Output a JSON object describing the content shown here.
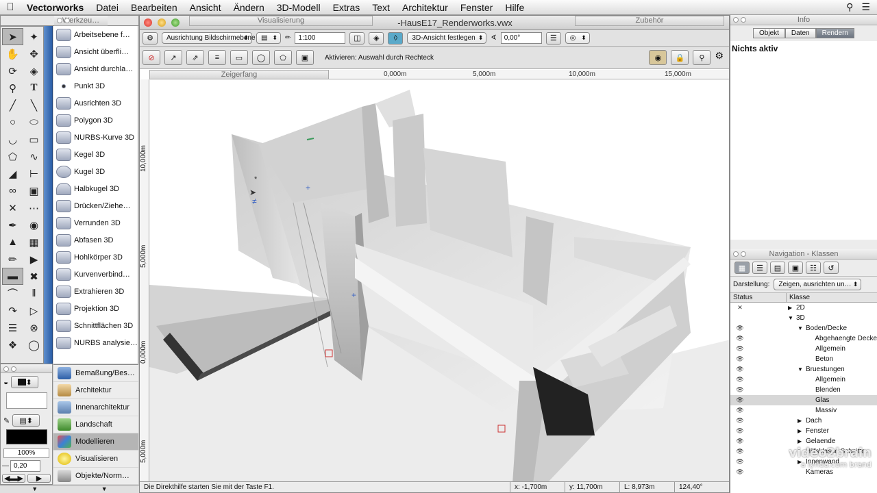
{
  "menubar": {
    "app": "Vectorworks",
    "items": [
      "Datei",
      "Bearbeiten",
      "Ansicht",
      "Ändern",
      "3D-Modell",
      "Extras",
      "Text",
      "Architektur",
      "Fenster",
      "Hilfe"
    ]
  },
  "palettes": {
    "werkzeug": "Werkzeu…",
    "visualisierung": "Visualisierung",
    "zubehoer": "Zubehör",
    "zeigerfang": "Zeigerfang",
    "info": "Info",
    "navigation": "Navigation - Klassen"
  },
  "document": {
    "title": "-HausE17_Renderworks.vwx",
    "ausrichtung": "Ausrichtung Bildschirmebene",
    "scale": "1:100",
    "view_mode": "3D-Ansicht festlegen",
    "angle": "0,00°",
    "mode_hint": "Aktivieren: Auswahl durch Rechteck",
    "ruler_h": [
      "0,000m",
      "5,000m",
      "10,000m",
      "15,000m"
    ],
    "ruler_v": [
      "10,000m",
      "5,000m",
      "0,000m",
      "5,000m"
    ],
    "status": "Die Direkthilfe starten Sie mit der Taste F1.",
    "coords": {
      "x": "x: -1,700m",
      "y": "y: 11,700m",
      "l": "L: 8,973m",
      "a": "124,40°"
    }
  },
  "tools3d": [
    "Arbeitsebene f…",
    "Ansicht überfli…",
    "Ansicht durchla…",
    "Punkt 3D",
    "Ausrichten 3D",
    "Polygon 3D",
    "NURBS-Kurve 3D",
    "Kegel 3D",
    "Kugel 3D",
    "Halbkugel 3D",
    "Drücken/Ziehe…",
    "Verrunden 3D",
    "Abfasen 3D",
    "Hohlkörper 3D",
    "Kurvenverbind…",
    "Extrahieren 3D",
    "Projektion 3D",
    "Schnittflächen 3D",
    "NURBS analysie…"
  ],
  "toolsets": [
    "Bemaßung/Bes…",
    "Architektur",
    "Innenarchitektur",
    "Landschaft",
    "Modellieren",
    "Visualisieren",
    "Objekte/Norm…"
  ],
  "attributes": {
    "zoom": "100%",
    "line_width": "0,20"
  },
  "info": {
    "tabs": [
      "Objekt",
      "Daten",
      "Rendern"
    ],
    "active_tab": "Rendern",
    "status": "Nichts aktiv"
  },
  "navigation": {
    "darstellung_label": "Darstellung:",
    "darstellung_value": "Zeigen, ausrichten un…",
    "col_status": "Status",
    "col_klasse": "Klasse",
    "rows": [
      {
        "label": "2D",
        "indent": 0,
        "arrow": "▶",
        "eye": "✕"
      },
      {
        "label": "3D",
        "indent": 0,
        "arrow": "▼",
        "eye": ""
      },
      {
        "label": "Boden/Decke",
        "indent": 1,
        "arrow": "▼",
        "eye": "👁"
      },
      {
        "label": "Abgehaengte Decke",
        "indent": 2,
        "arrow": "",
        "eye": "👁"
      },
      {
        "label": "Allgemein",
        "indent": 2,
        "arrow": "",
        "eye": "👁"
      },
      {
        "label": "Beton",
        "indent": 2,
        "arrow": "",
        "eye": "👁"
      },
      {
        "label": "Bruestungen",
        "indent": 1,
        "arrow": "▼",
        "eye": "👁"
      },
      {
        "label": "Allgemein",
        "indent": 2,
        "arrow": "",
        "eye": "👁"
      },
      {
        "label": "Blenden",
        "indent": 2,
        "arrow": "",
        "eye": "👁"
      },
      {
        "label": "Glas",
        "indent": 2,
        "arrow": "",
        "eye": "👁",
        "selected": true
      },
      {
        "label": "Massiv",
        "indent": 2,
        "arrow": "",
        "eye": "👁"
      },
      {
        "label": "Dach",
        "indent": 1,
        "arrow": "▶",
        "eye": "👁"
      },
      {
        "label": "Fenster",
        "indent": 1,
        "arrow": "▶",
        "eye": "👁"
      },
      {
        "label": "Gelaende",
        "indent": 1,
        "arrow": "▶",
        "eye": "👁"
      },
      {
        "label": "Hilfsklasse Schnitte",
        "indent": 1,
        "arrow": "",
        "eye": "👁"
      },
      {
        "label": "Innenwand",
        "indent": 1,
        "arrow": "▶",
        "eye": "👁"
      },
      {
        "label": "Kameras",
        "indent": 1,
        "arrow": "",
        "eye": "👁"
      }
    ]
  },
  "watermark": {
    "line1": "video2brain",
    "line2": "a lynda.com brand"
  }
}
